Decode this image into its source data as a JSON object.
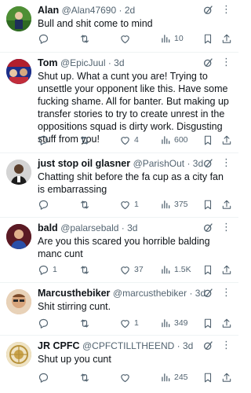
{
  "tweets": [
    {
      "name": "Alan",
      "handle": "@Alan47690",
      "time": "2d",
      "text": "Bull and shit come to mind",
      "reply_count": "",
      "retweet_count": "",
      "like_count": "",
      "view_count": "10",
      "avatar_color": "#3f7a2c"
    },
    {
      "name": "Tom",
      "handle": "@EpicJuul",
      "time": "3d",
      "text": "Shut up. What a cunt you are! Trying to unsettle your opponent like this. Have some fucking shame. All for banter. But making up transfer stories to try to create unrest in the oppositions squad is dirty work. Disgusting stuff from you!",
      "reply_count": "",
      "retweet_count": "",
      "like_count": "4",
      "view_count": "600",
      "avatar_color": "#1d2f8a"
    },
    {
      "name": "just stop oil glasner",
      "handle": "@ParishOut",
      "time": "3d",
      "text": "Chatting shit before the fa cup as a city fan is embarrassing",
      "reply_count": "",
      "retweet_count": "",
      "like_count": "1",
      "view_count": "375",
      "avatar_color": "#c9c9c9"
    },
    {
      "name": "bald",
      "handle": "@palarsebald",
      "time": "3d",
      "text": "Are you this scared you horrible balding manc cunt",
      "reply_count": "1",
      "retweet_count": "",
      "like_count": "37",
      "view_count": "1.5K",
      "avatar_color": "#6a1f2a"
    },
    {
      "name": "Marcusthebiker",
      "handle": "@marcusthebiker",
      "time": "3d",
      "text": "Shit stirring cunt.",
      "reply_count": "",
      "retweet_count": "",
      "like_count": "1",
      "view_count": "349",
      "avatar_color": "#d9a27a"
    },
    {
      "name": "JR CPFC",
      "handle": "@CPFCTILLTHEEND",
      "time": "3d",
      "text": "Shut up you cunt",
      "reply_count": "",
      "retweet_count": "",
      "like_count": "",
      "view_count": "245",
      "avatar_color": "#b8923a"
    }
  ],
  "icons": {
    "reply": "reply-icon",
    "retweet": "retweet-icon",
    "like": "like-icon",
    "views": "views-icon",
    "bookmark": "bookmark-icon",
    "share": "share-icon",
    "grok": "grok-icon",
    "more": "more-icon"
  },
  "colors": {
    "text": "#0f1419",
    "secondary": "#536471",
    "divider": "#eff3f4"
  }
}
